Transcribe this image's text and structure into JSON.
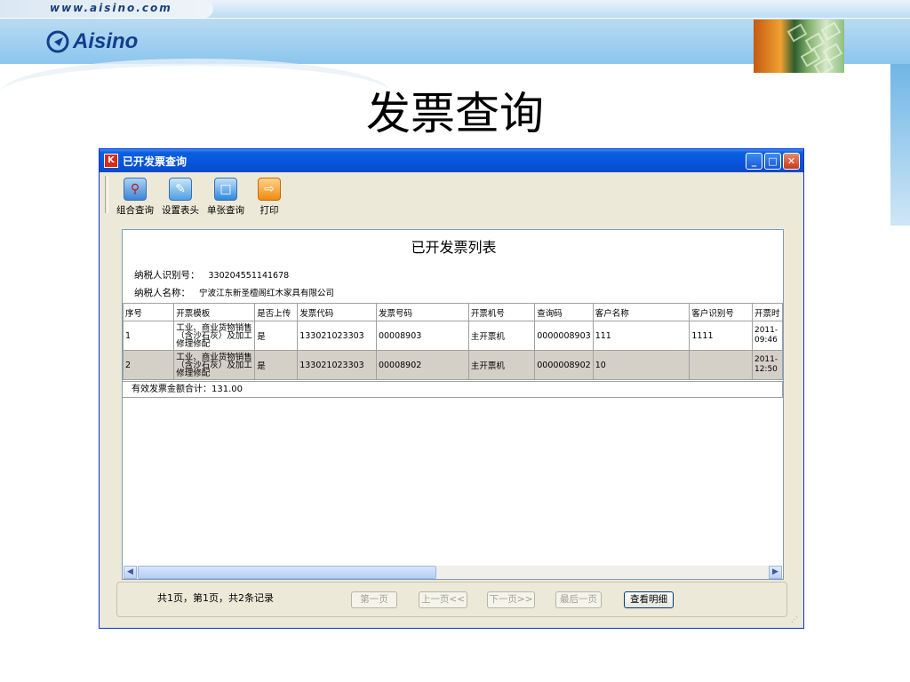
{
  "slide": {
    "url": "www.aisino.com",
    "logo_text": "Aisino",
    "title": "发票查询"
  },
  "window": {
    "title": "已开发票查询",
    "icon": "app-icon",
    "controls": {
      "minimize": "minimize-icon",
      "maximize": "maximize-icon",
      "close": "close-icon"
    }
  },
  "toolbar": [
    {
      "label": "组合查询",
      "icon": "search-icon"
    },
    {
      "label": "设置表头",
      "icon": "header-settings-icon"
    },
    {
      "label": "单张查询",
      "icon": "folder-icon"
    },
    {
      "label": "打印",
      "icon": "print-icon"
    }
  ],
  "report": {
    "title": "已开发票列表",
    "taxpayer_id_label": "纳税人识别号：",
    "taxpayer_id": "330204551141678",
    "taxpayer_name_label": "纳税人名称：",
    "taxpayer_name": "宁波江东新圣檀阁红木家具有限公司",
    "columns": [
      "序号",
      "开票模板",
      "是否上传",
      "发票代码",
      "发票号码",
      "开票机号",
      "查询码",
      "客户名称",
      "客户识别号",
      "开票时"
    ],
    "rows": [
      [
        "1",
        "工业、商业货物销售（含沙石灰）及加工修理修配",
        "是",
        "133021023303",
        "00008903",
        "主开票机",
        "0000008903",
        "111",
        "1111",
        "2011-\n09:46"
      ],
      [
        "2",
        "工业、商业货物销售（含沙石灰）及加工修理修配",
        "是",
        "133021023303",
        "00008902",
        "主开票机",
        "0000008902",
        "10",
        "",
        "2011-\n12:50"
      ]
    ],
    "total_label": "有效发票金额合计：",
    "total_value": "131.00"
  },
  "pagination": {
    "record_info": "共1页，第1页，共2条记录",
    "first": "第一页",
    "prev": "上一页<<",
    "next": "下一页>>",
    "last": "最后一页",
    "detail": "查看明细"
  }
}
